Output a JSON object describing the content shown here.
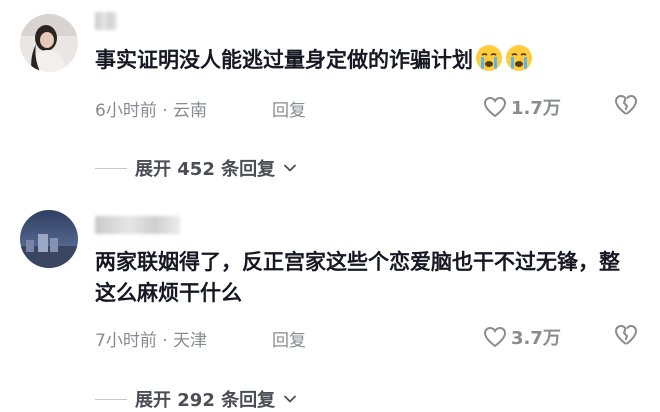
{
  "comments": [
    {
      "content": "事实证明没人能逃过量身定做的诈骗计划",
      "emojis": [
        "crying-face-icon",
        "crying-face-icon"
      ],
      "time": "6小时前",
      "separator": "·",
      "location": "云南",
      "reply_label": "回复",
      "likes": "1.7万",
      "expand_prefix": "展开",
      "expand_count": "452",
      "expand_suffix": "条回复"
    },
    {
      "content": "两家联姻得了，反正宫家这些个恋爱脑也干不过无锋，整这么麻烦干什么",
      "time": "7小时前",
      "separator": "·",
      "location": "天津",
      "reply_label": "回复",
      "likes": "3.7万",
      "expand_prefix": "展开",
      "expand_count": "292",
      "expand_suffix": "条回复"
    }
  ],
  "colors": {
    "text": "#161823",
    "meta": "#8a8b91",
    "expand": "#4d4e55"
  }
}
